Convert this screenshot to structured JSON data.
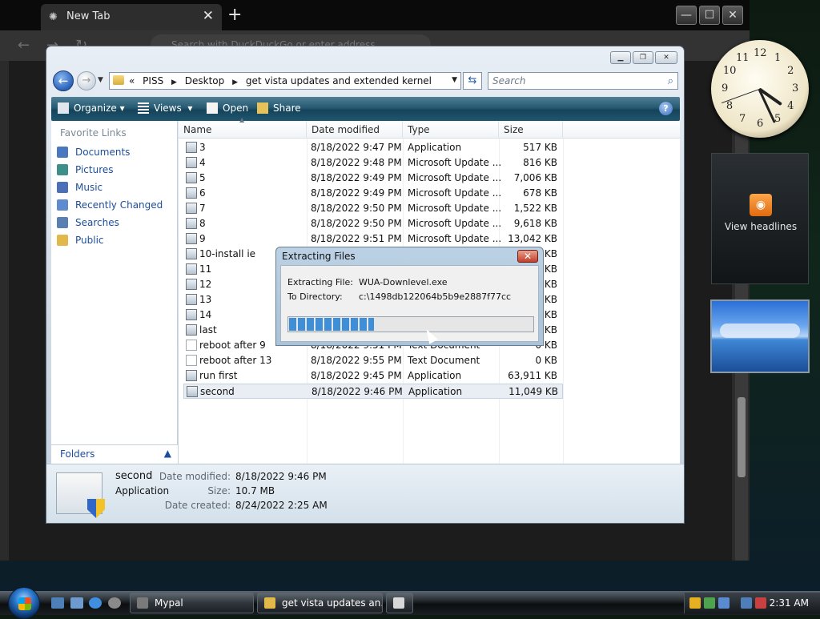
{
  "browser": {
    "tab_title": "New Tab",
    "tab_close": "✕",
    "new_tab": "+",
    "omnibox_placeholder": "Search with DuckDuckGo or enter address"
  },
  "explorer": {
    "breadcrumb": [
      "«",
      "PISS",
      "Desktop",
      "get vista updates and extended kernel"
    ],
    "search_placeholder": "Search",
    "toolbar": {
      "organize": "Organize",
      "views": "Views",
      "open": "Open",
      "share": "Share",
      "help": "?"
    },
    "nav_header": "Favorite Links",
    "nav_items": [
      {
        "label": "Documents",
        "color": "#4a78c0"
      },
      {
        "label": "Pictures",
        "color": "#3e8e8a"
      },
      {
        "label": "Music",
        "color": "#4b6fb8"
      },
      {
        "label": "Recently Changed",
        "color": "#5f8ad0"
      },
      {
        "label": "Searches",
        "color": "#5a7fb3"
      },
      {
        "label": "Public",
        "color": "#e2b84a"
      }
    ],
    "folders_label": "Folders",
    "columns": [
      "Name",
      "Date modified",
      "Type",
      "Size"
    ],
    "files": [
      {
        "name": "3",
        "date": "8/18/2022 9:47 PM",
        "type": "Application",
        "size": "517 KB"
      },
      {
        "name": "4",
        "date": "8/18/2022 9:48 PM",
        "type": "Microsoft Update ...",
        "size": "816 KB"
      },
      {
        "name": "5",
        "date": "8/18/2022 9:49 PM",
        "type": "Microsoft Update ...",
        "size": "7,006 KB"
      },
      {
        "name": "6",
        "date": "8/18/2022 9:49 PM",
        "type": "Microsoft Update ...",
        "size": "678 KB"
      },
      {
        "name": "7",
        "date": "8/18/2022 9:50 PM",
        "type": "Microsoft Update ...",
        "size": "1,522 KB"
      },
      {
        "name": "8",
        "date": "8/18/2022 9:50 PM",
        "type": "Microsoft Update ...",
        "size": "9,618 KB"
      },
      {
        "name": "9",
        "date": "8/18/2022 9:51 PM",
        "type": "Microsoft Update ...",
        "size": "13,042 KB"
      },
      {
        "name": "10-install ie",
        "date": "",
        "type": "",
        "size": "KB"
      },
      {
        "name": "11",
        "date": "",
        "type": "",
        "size": "KB"
      },
      {
        "name": "12",
        "date": "",
        "type": "",
        "size": "KB"
      },
      {
        "name": "13",
        "date": "",
        "type": "",
        "size": "KB"
      },
      {
        "name": "14",
        "date": "",
        "type": "",
        "size": "KB"
      },
      {
        "name": "last",
        "date": "",
        "type": "",
        "size": "KB"
      },
      {
        "name": "reboot after 9",
        "date": "8/18/2022 9:51 PM",
        "type": "Text Document",
        "size": "0 KB"
      },
      {
        "name": "reboot after 13",
        "date": "8/18/2022 9:55 PM",
        "type": "Text Document",
        "size": "0 KB"
      },
      {
        "name": "run first",
        "date": "8/18/2022 9:45 PM",
        "type": "Application",
        "size": "63,911 KB"
      },
      {
        "name": "second",
        "date": "8/18/2022 9:46 PM",
        "type": "Application",
        "size": "11,049 KB"
      }
    ],
    "details": {
      "name": "second",
      "type": "Application",
      "date_modified_label": "Date modified:",
      "date_modified": "8/18/2022 9:46 PM",
      "size_label": "Size:",
      "size": "10.7 MB",
      "date_created_label": "Date created:",
      "date_created": "8/24/2022 2:25 AM"
    }
  },
  "dialog": {
    "title": "Extracting Files",
    "close": "✕",
    "file_label": "Extracting File:",
    "file_value": "WUA-Downlevel.exe",
    "dir_label": "To Directory:",
    "dir_value": "c:\\1498db122064b5b9e2887f77cc",
    "progress": 0.35
  },
  "sidebar": {
    "clock_numbers": [
      "12",
      "1",
      "2",
      "3",
      "4",
      "5",
      "6",
      "7",
      "8",
      "9",
      "10",
      "11"
    ],
    "headlines_label": "View headlines"
  },
  "taskbar": {
    "buttons": [
      "Mypal",
      "get vista updates an..."
    ],
    "time": "2:31 AM"
  }
}
